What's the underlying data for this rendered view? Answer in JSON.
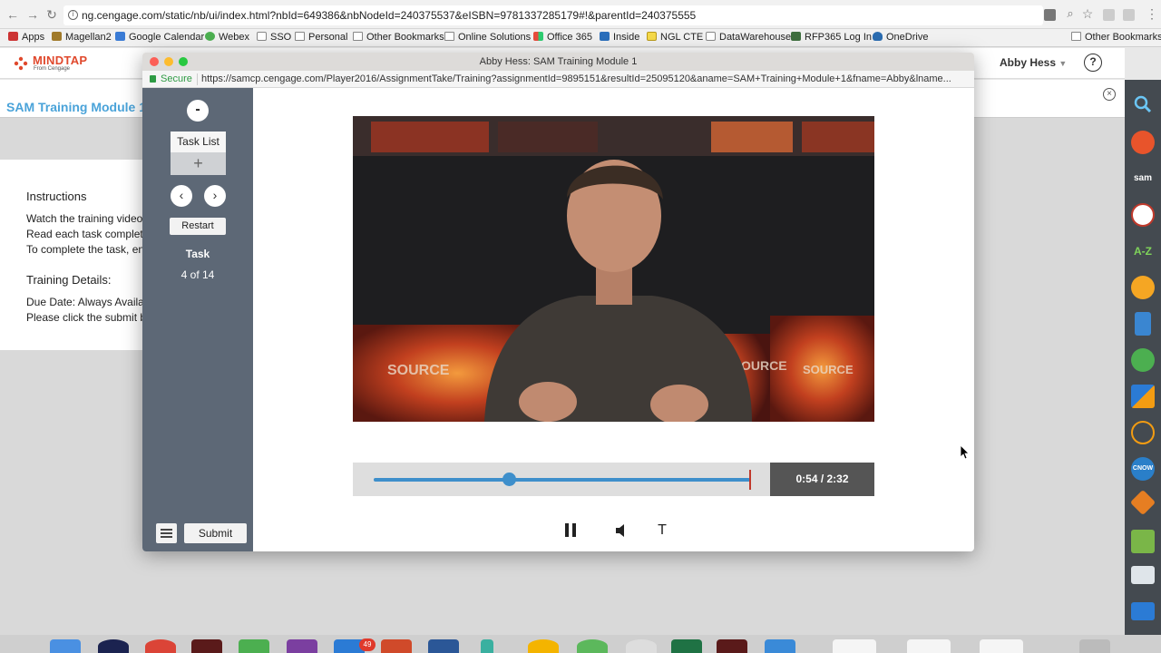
{
  "browser": {
    "url": "ng.cengage.com/static/nb/ui/index.html?nbId=649386&nbNodeId=240375537&eISBN=9781337285179#!&parentId=240375555",
    "bookmarks": [
      "Apps",
      "Magellan2",
      "Google Calendar",
      "Webex",
      "SSO",
      "Personal",
      "Other Bookmarks",
      "Online Solutions",
      "Office 365",
      "Inside",
      "NGL CTE",
      "DataWarehouse",
      "RFP365 Log In",
      "OneDrive"
    ],
    "bookmarks_right": "Other Bookmarks"
  },
  "app": {
    "logo_text": "MINDTAP",
    "logo_sub": "From Cengage",
    "user_name": "Abby Hess",
    "help_label": "?"
  },
  "background_page": {
    "title": "SAM Training Module 1",
    "instructions_heading": "Instructions",
    "line1": "Watch the training videos",
    "line2": "Read each task complete",
    "line3": "To complete the task, ent",
    "details_heading": "Training Details:",
    "due_date": "Due Date: Always Availab",
    "submit_note": "Please click the submit b"
  },
  "popup": {
    "window_title": "Abby Hess: SAM Training Module 1",
    "secure_label": "Secure",
    "url": "https://samcp.cengage.com/Player2016/AssignmentTake/Training?assignmentId=9895151&resultId=25095120&aname=SAM+Training+Module+1&fname=Abby&lname..."
  },
  "player": {
    "collapse_label": "-",
    "task_list_label": "Task List",
    "task_list_add": "+",
    "prev_label": "‹",
    "next_label": "›",
    "restart_label": "Restart",
    "task_heading": "Task",
    "task_progress": "4 of 14",
    "submit_label": "Submit",
    "time_display": "0:54 / 2:32",
    "played_fraction": 0.36,
    "text_toggle_label": "T",
    "video_watermark_1": "SOURCE",
    "video_watermark_2": "SOURCE",
    "video_watermark_3": "OURCE"
  },
  "dock": {
    "mail_badge": "49"
  }
}
